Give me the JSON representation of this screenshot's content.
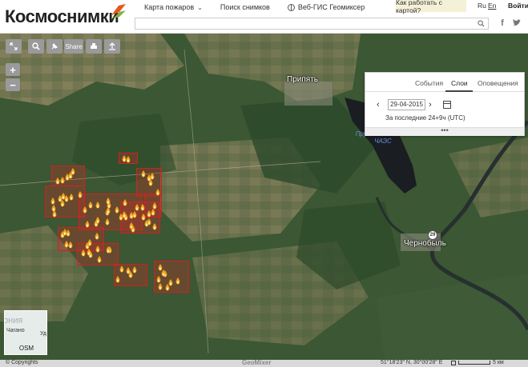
{
  "header": {
    "logo": "Космоснимки",
    "nav": [
      {
        "label": "Карта пожаров"
      },
      {
        "label": "Поиск снимков"
      },
      {
        "label": "Веб-ГИС Геомиксер"
      }
    ],
    "help": "Как работать с картой?",
    "lang_ru": "Ru",
    "lang_en": "En",
    "login": "Войти",
    "search_placeholder": ""
  },
  "map": {
    "toolbar": {
      "share": "Share"
    },
    "labels": {
      "pripyat": "Припять",
      "chernobyl": "Чернобыль",
      "reservoir": "Пруд-Охладитель ЧАЭС",
      "road": "29"
    }
  },
  "panel": {
    "tabs": [
      "События",
      "Слои",
      "Оповещения"
    ],
    "active_tab": "Слои",
    "date": "29-04-2015",
    "period": "За последние 24+9ч (UTC)",
    "handle": "•••"
  },
  "minimap": {
    "label": "OSM",
    "t1": "ония",
    "t2": "Чагано",
    "t3": "Уд"
  },
  "footer": {
    "copyright": "© Copyrights",
    "brand": "GeoMixer",
    "coords": "51°18′23″ N, 30°00′28″ E",
    "scale": "5 км"
  },
  "colors": {
    "fire": "#d61f1f",
    "help_bg": "#f5f1d7",
    "forest": "#2c4a2a"
  }
}
